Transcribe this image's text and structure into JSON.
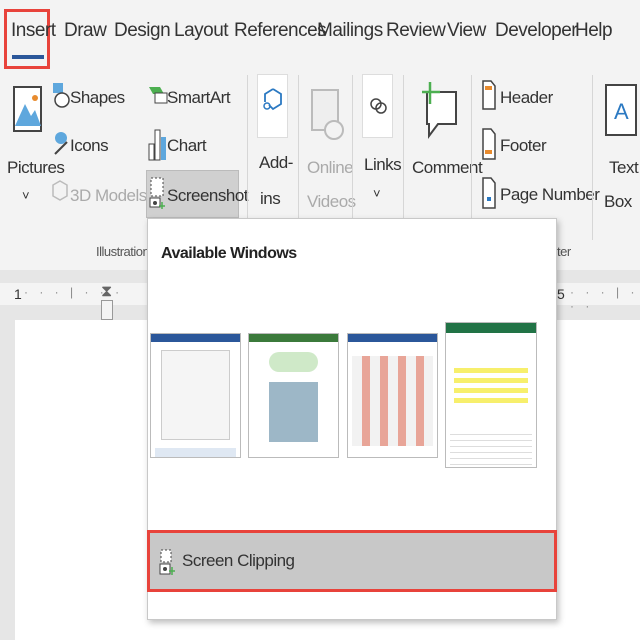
{
  "tabs": [
    "Insert",
    "Draw",
    "Design",
    "Layout",
    "References",
    "Mailings",
    "Review",
    "View",
    "Developer",
    "Help"
  ],
  "active_tab": "Insert",
  "ribbon": {
    "pictures": "Pictures",
    "shapes": "Shapes",
    "icons": "Icons",
    "models": "3D Models",
    "smartart": "SmartArt",
    "chart": "Chart",
    "screenshot": "Screenshot",
    "illustrations": "Illustrations",
    "addins1": "Add-",
    "addins2": "ins",
    "online1": "Online",
    "online2": "Videos",
    "links": "Links",
    "comment": "Comment",
    "header": "Header",
    "footer": "Footer",
    "page_number": "Page Number",
    "hf_group_partial": "ter",
    "text1": "Text",
    "text2": "Box",
    "chev": "˅"
  },
  "ruler": {
    "left_num": "1",
    "right_num": "5"
  },
  "dropdown": {
    "title": "Available Windows",
    "screen_clipping": "Screen Clipping"
  },
  "colors": {
    "accent": "#2b579a",
    "highlight": "#e8433b"
  }
}
